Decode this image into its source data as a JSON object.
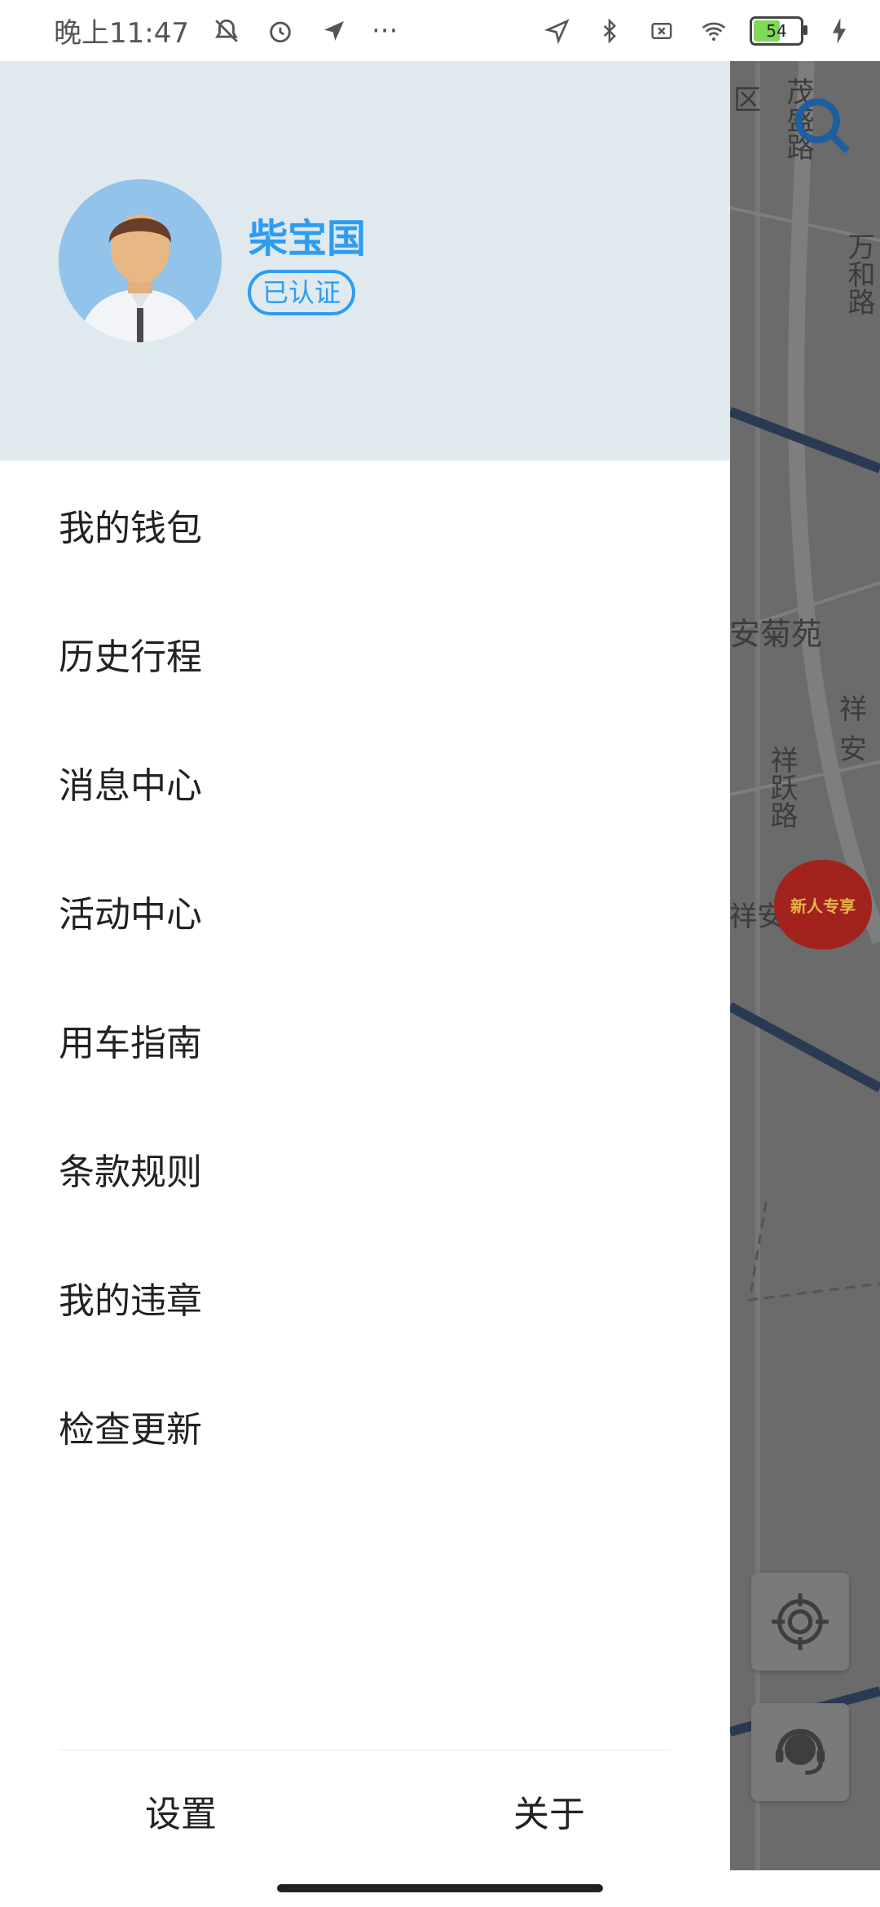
{
  "status_bar": {
    "time": "晚上11:47",
    "more": "···",
    "battery_level": "54"
  },
  "map": {
    "street_labels": [
      "区",
      "茂盛路",
      "万和路",
      "安菊苑",
      "祥安",
      "祥跃路",
      "祥安"
    ],
    "promo_text": "新人专享"
  },
  "drawer": {
    "user_name": "柴宝国",
    "verified_label": "已认证",
    "menu_items": [
      {
        "label": "我的钱包"
      },
      {
        "label": "历史行程"
      },
      {
        "label": "消息中心"
      },
      {
        "label": "活动中心"
      },
      {
        "label": "用车指南"
      },
      {
        "label": "条款规则"
      },
      {
        "label": "我的违章"
      },
      {
        "label": "检查更新"
      }
    ],
    "footer": {
      "settings_label": "设置",
      "about_label": "关于"
    }
  },
  "colors": {
    "accent": "#2d9cf2",
    "header_bg": "#dfe9ee",
    "map_overlay": "#6b6b6b"
  }
}
